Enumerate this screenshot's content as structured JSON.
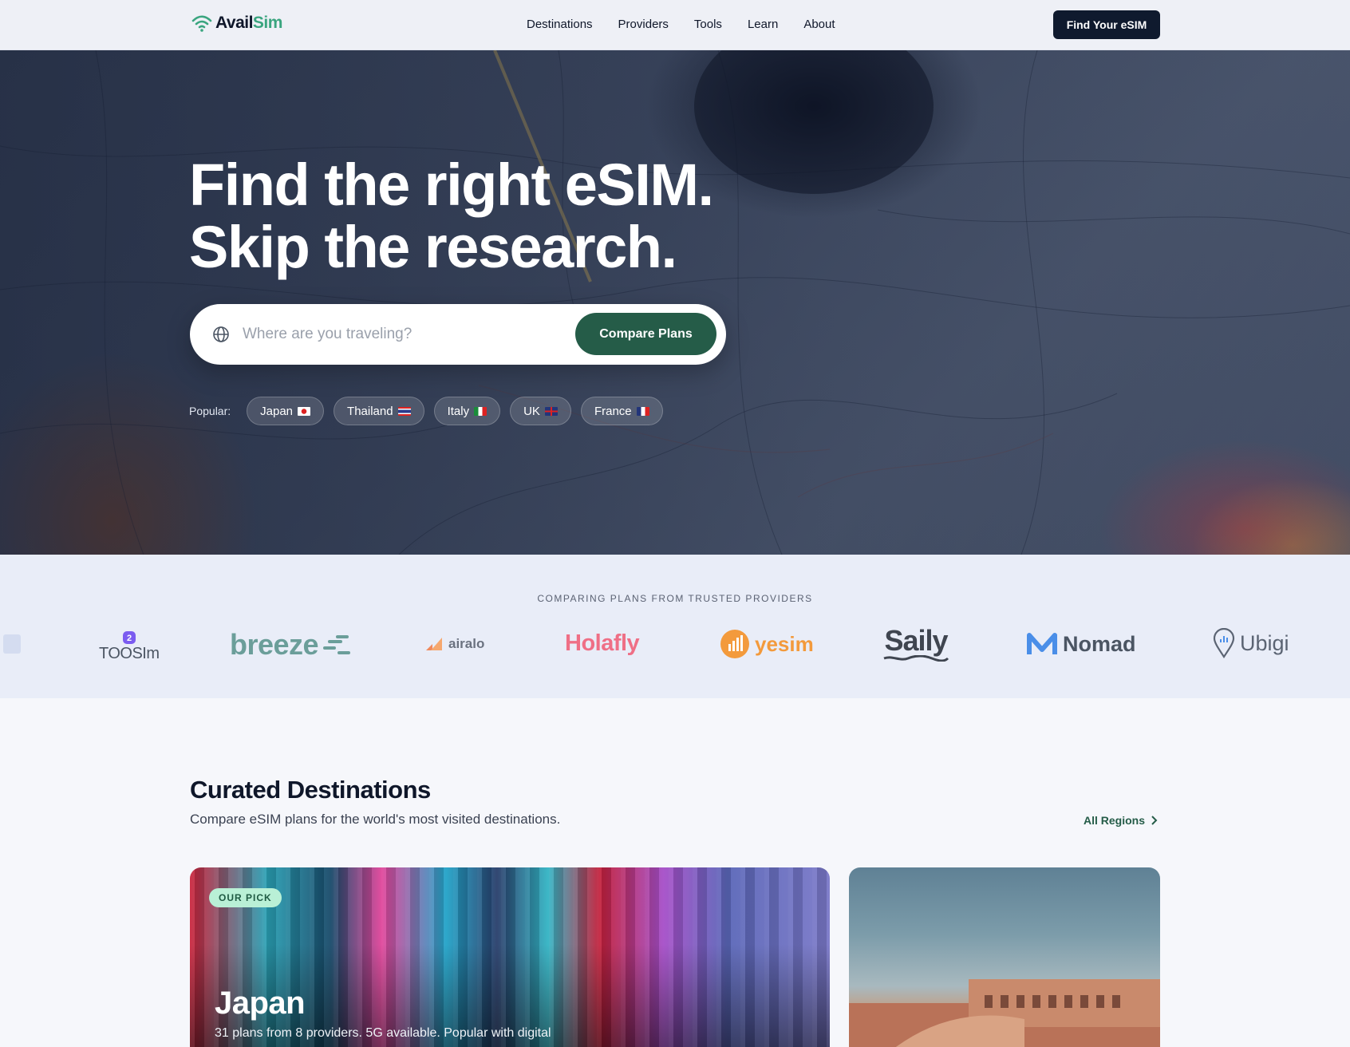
{
  "nav": {
    "logo_part1": "Avail",
    "logo_part2": "Sim",
    "links": [
      "Destinations",
      "Providers",
      "Tools",
      "Learn",
      "About"
    ],
    "cta": "Find Your eSIM"
  },
  "hero": {
    "title_line1": "Find the right eSIM.",
    "title_line2": "Skip the research.",
    "search_placeholder": "Where are you traveling?",
    "search_button": "Compare Plans",
    "popular_label": "Popular:",
    "popular": [
      {
        "label": "Japan",
        "flag": "japan"
      },
      {
        "label": "Thailand",
        "flag": "thailand"
      },
      {
        "label": "Italy",
        "flag": "italy"
      },
      {
        "label": "UK",
        "flag": "uk"
      },
      {
        "label": "France",
        "flag": "france"
      }
    ]
  },
  "providers": {
    "title": "COMPARING PLANS FROM TRUSTED PROVIDERS",
    "brands": [
      "TOOSIm",
      "breeze",
      "airalo",
      "Holafly",
      "yesim",
      "Saily",
      "Nomad",
      "Ubigi"
    ]
  },
  "curated": {
    "title": "Curated Destinations",
    "subtitle": "Compare eSIM plans for the world's most visited destinations.",
    "all_regions": "All Regions",
    "cards": [
      {
        "badge": "OUR PICK",
        "title": "Japan",
        "desc": "31 plans from 8 providers. 5G available. Popular with digital"
      }
    ]
  },
  "colors": {
    "brand_green": "#255c48",
    "accent_mint": "#3aa57f",
    "dark_navy": "#0f1a2e"
  }
}
